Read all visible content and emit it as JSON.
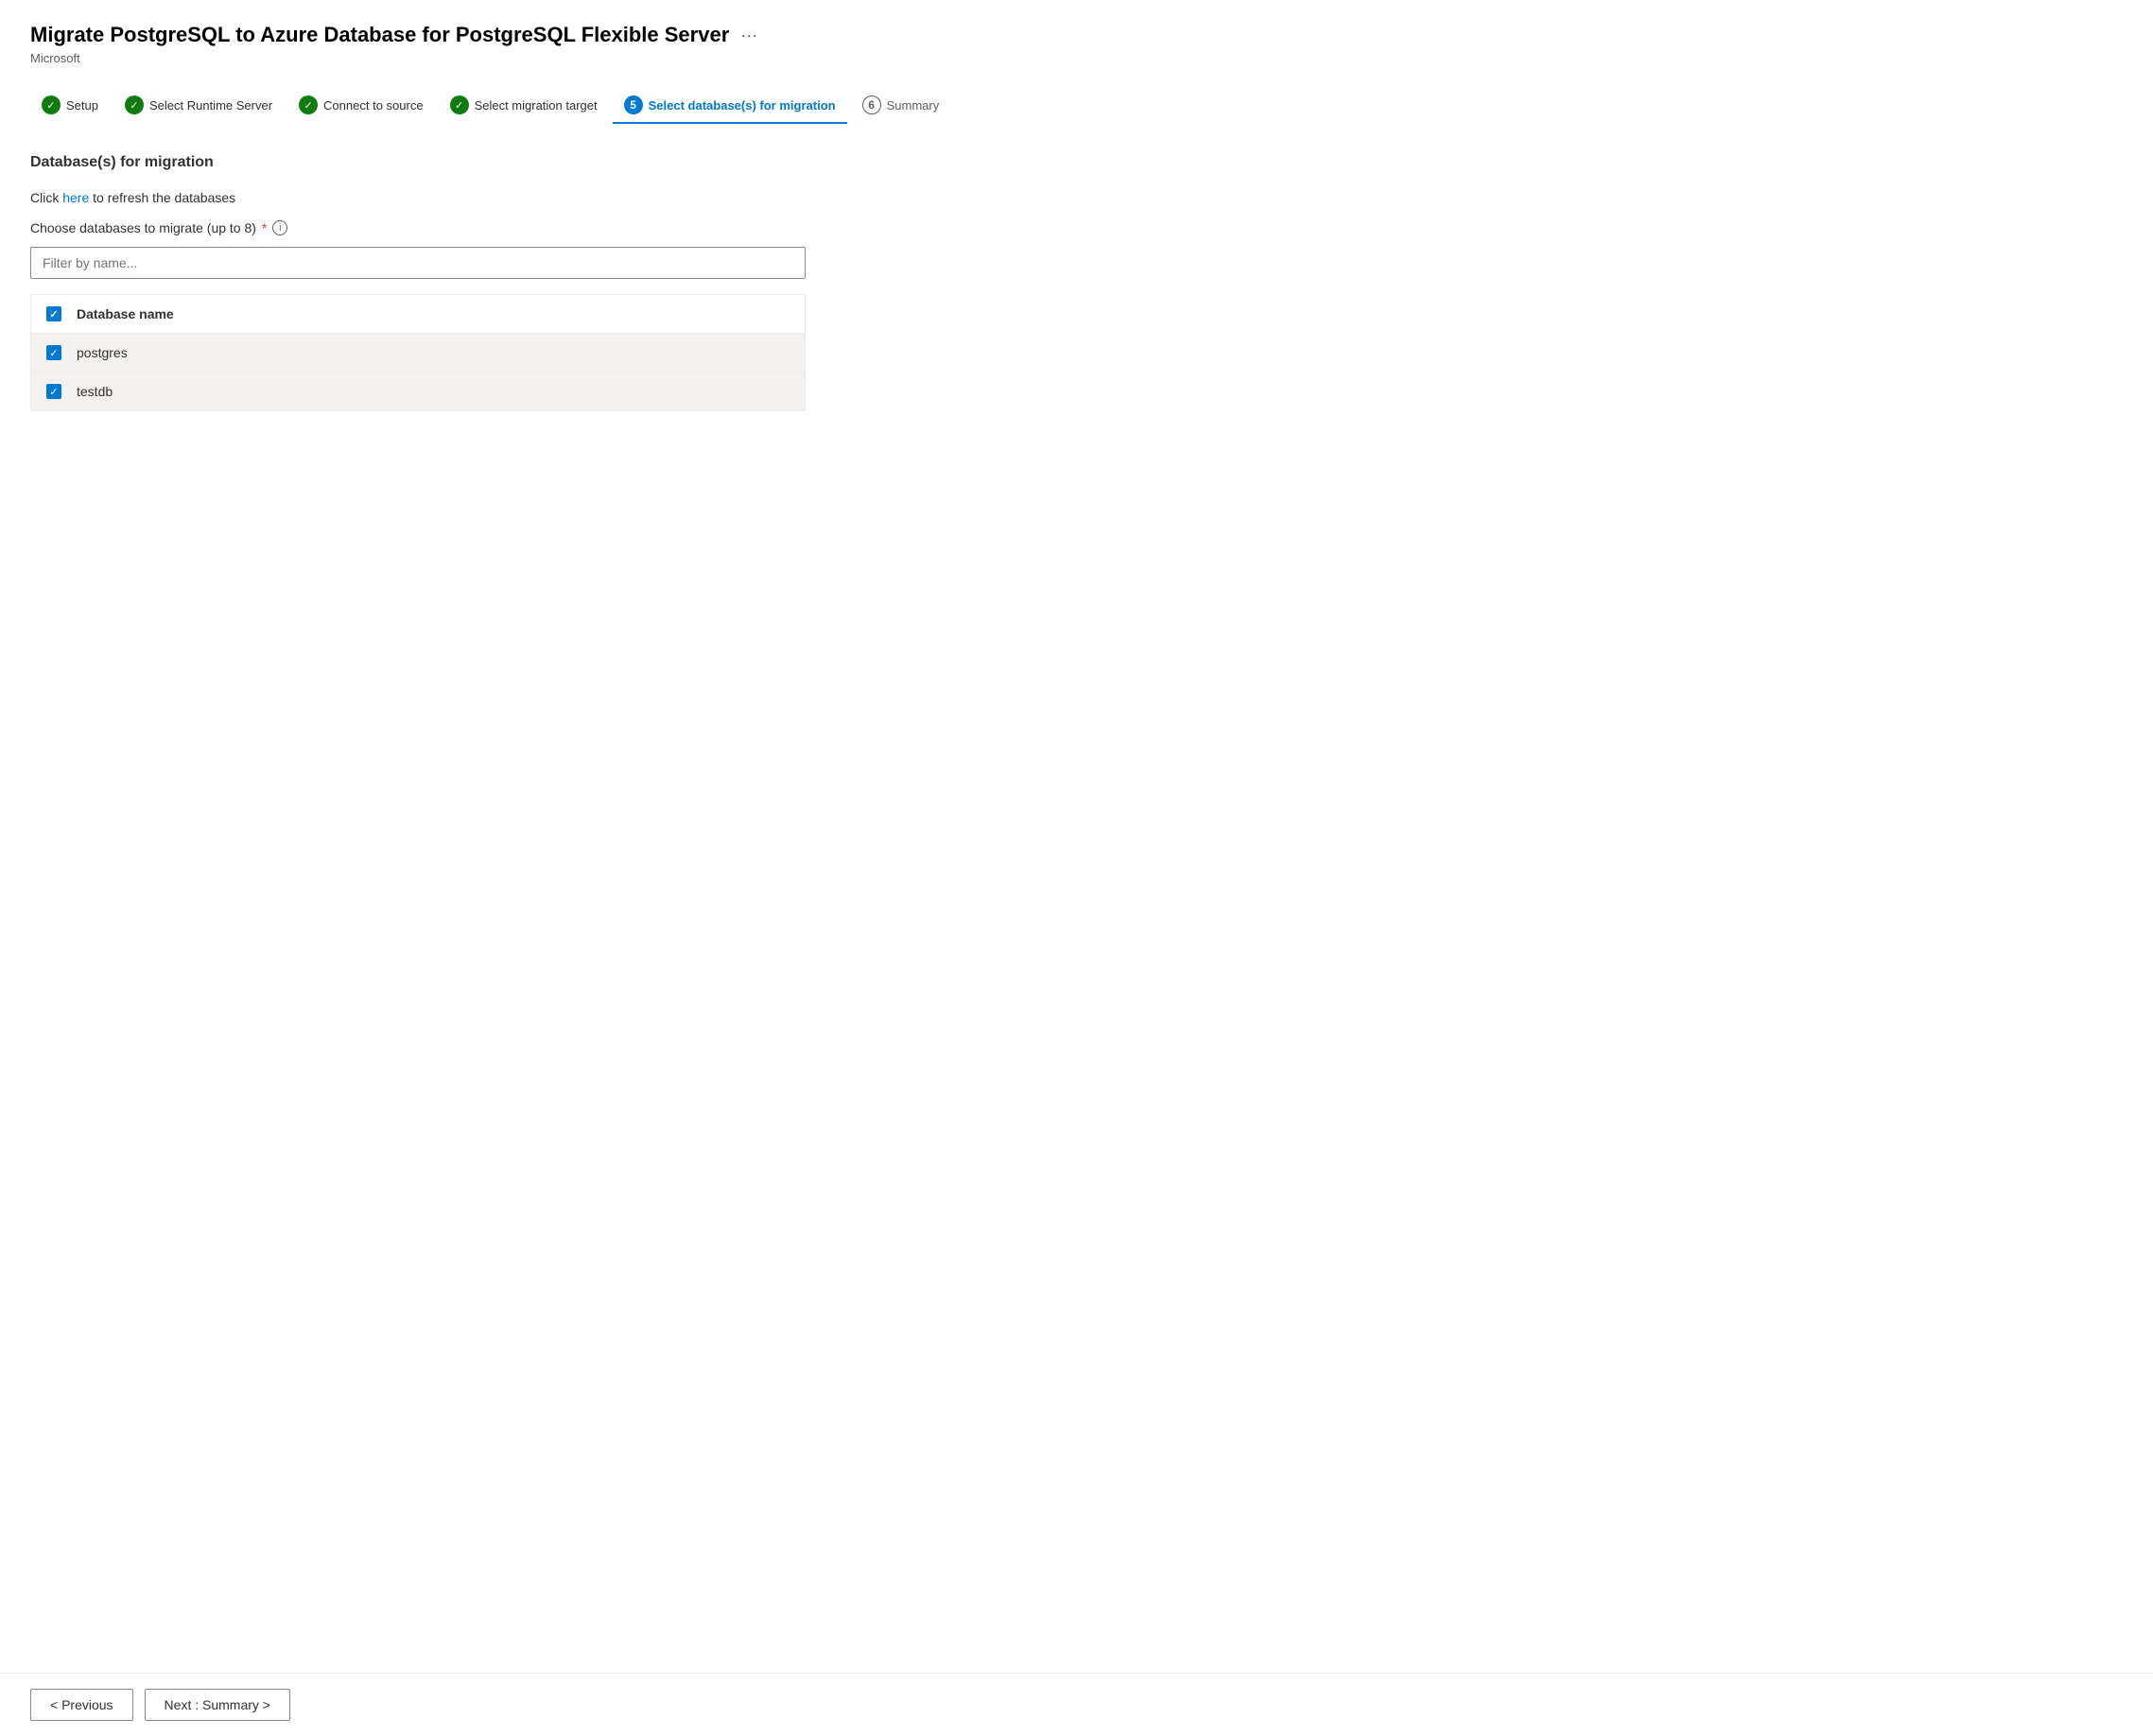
{
  "header": {
    "title": "Migrate PostgreSQL to Azure Database for PostgreSQL Flexible Server",
    "subtitle": "Microsoft",
    "ellipsis": "···"
  },
  "steps": [
    {
      "id": "setup",
      "label": "Setup",
      "state": "completed",
      "number": 1
    },
    {
      "id": "runtime",
      "label": "Select Runtime Server",
      "state": "completed",
      "number": 2
    },
    {
      "id": "connect-source",
      "label": "Connect to source",
      "state": "completed",
      "number": 3
    },
    {
      "id": "migration-target",
      "label": "Select migration target",
      "state": "completed",
      "number": 4
    },
    {
      "id": "select-db",
      "label": "Select database(s) for migration",
      "state": "active",
      "number": 5
    },
    {
      "id": "summary",
      "label": "Summary",
      "state": "upcoming",
      "number": 6
    }
  ],
  "section": {
    "title": "Database(s) for migration",
    "refresh_text_prefix": "Click ",
    "refresh_link": "here",
    "refresh_text_suffix": " to refresh the databases",
    "choose_label": "Choose databases to migrate (up to 8)",
    "required_marker": "*",
    "filter_placeholder": "Filter by name...",
    "table": {
      "header_checkbox": true,
      "column_name": "Database name",
      "rows": [
        {
          "name": "postgres",
          "checked": true
        },
        {
          "name": "testdb",
          "checked": true
        }
      ]
    }
  },
  "footer": {
    "previous_label": "< Previous",
    "next_label": "Next : Summary >"
  }
}
